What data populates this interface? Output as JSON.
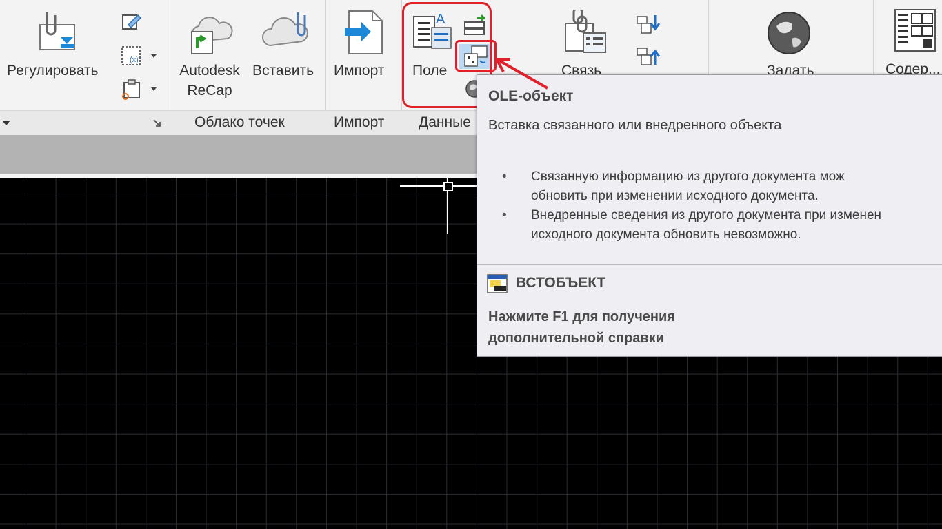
{
  "ribbon": {
    "buttons": {
      "adjust_label": "Регулировать",
      "recap_label_line1": "Autodesk",
      "recap_label_line2": "ReCap",
      "paste_label": "Вставить",
      "import_label": "Импорт",
      "field_label": "Поле",
      "link_label": "Связь",
      "set_label": "Задать",
      "contents_label": "Содер..."
    },
    "panels": {
      "point_cloud": "Облако точек",
      "import": "Импорт",
      "data": "Данные"
    }
  },
  "tooltip": {
    "title": "OLE-объект",
    "description": "Вставка связанного или внедренного объекта",
    "bullets": [
      "Связанную информацию из другого документа можно обновить при изменении исходного документа.",
      "Внедренные сведения из другого документа при изменении исходного документа обновить невозможно."
    ],
    "bullet_lines": [
      [
        "Связанную   информацию   из   другого   документа   мож",
        "обновить при изменении исходного документа."
      ],
      [
        "Внедренные сведения из другого документа при изменен",
        "исходного документа обновить невозможно."
      ]
    ],
    "command": "ВСТОБЪЕКТ",
    "help": "Нажмите F1 для получения дополнительной справки"
  },
  "colors": {
    "ribbon_bg": "#f3f3f3",
    "canvas_bg": "#000000",
    "grid": "#2a2d33",
    "highlight_red": "#e2202b",
    "tooltip_bg": "#eeeef3"
  },
  "icons": [
    "attach-icon",
    "clip-icon",
    "clipboard-icon",
    "recap-icon",
    "cloud-paste-icon",
    "import-icon",
    "field-icon",
    "data-extract-icon",
    "ole-object-icon",
    "hyperlink-icon",
    "link-icon",
    "download-icon",
    "upload-icon",
    "globe-icon",
    "table-icon"
  ]
}
